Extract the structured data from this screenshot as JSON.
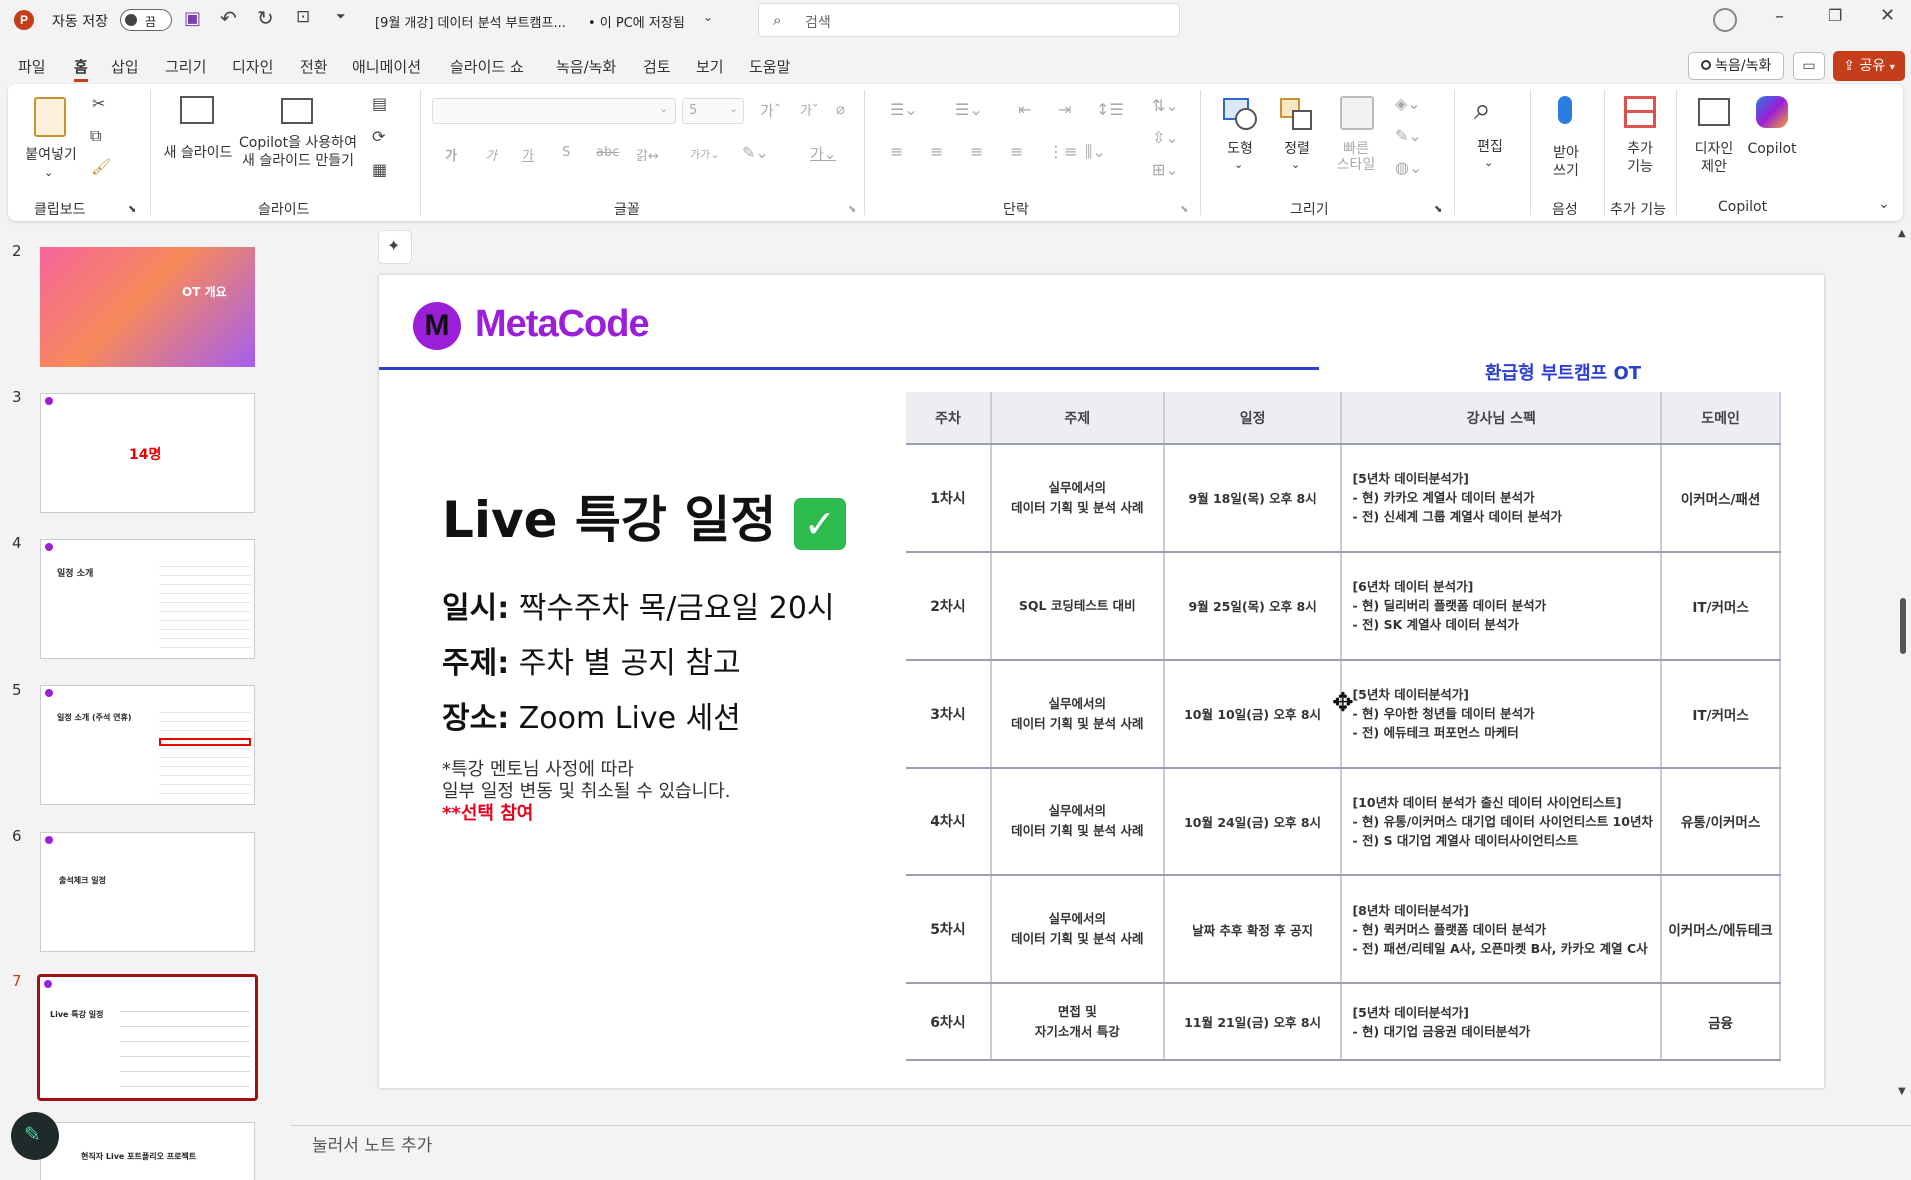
{
  "titlebar": {
    "autosave_label": "자동 저장",
    "autosave_state": "끔",
    "doc_title": "[9월 개강] 데이터 분석 부트캠프...",
    "save_location": "• 이 PC에 저장됨",
    "search_placeholder": "검색"
  },
  "menu": [
    "파일",
    "홈",
    "삽입",
    "그리기",
    "디자인",
    "전환",
    "애니메이션",
    "슬라이드 쇼",
    "녹음/녹화",
    "검토",
    "보기",
    "도움말"
  ],
  "menu_right": {
    "record": "녹음/녹화",
    "share": "공유"
  },
  "ribbon": {
    "paste": "붙여넣기",
    "new_slide": "새 슬라이드",
    "copilot_new_1": "Copilot을 사용하여",
    "copilot_new_2": "새 슬라이드 만들기",
    "font_size": "5",
    "shape": "도형",
    "arrange": "정렬",
    "quick_style_1": "빠른",
    "quick_style_2": "스타일",
    "edit": "편집",
    "dictate_1": "받아",
    "dictate_2": "쓰기",
    "addins_1": "추가",
    "addins_2": "기능",
    "designer_1": "디자인",
    "designer_2": "제안",
    "copilot": "Copilot",
    "groups": {
      "clipboard": "클립보드",
      "slides": "슬라이드",
      "font": "글꼴",
      "paragraph": "단락",
      "drawing": "그리기",
      "voice": "음성",
      "addins": "추가 기능",
      "copilot": "Copilot"
    }
  },
  "thumbnails": [
    {
      "num": "2",
      "title": "OT 개요"
    },
    {
      "num": "3",
      "title": "14명"
    },
    {
      "num": "4",
      "title": "일정 소개"
    },
    {
      "num": "5",
      "title": "일정 소개 (주석 연휴)"
    },
    {
      "num": "6",
      "title": "출석체크 일정"
    },
    {
      "num": "7",
      "title": "Live 특강 일정"
    },
    {
      "num": "",
      "title": "현직자 Live 포트폴리오 프로젝트"
    }
  ],
  "slide": {
    "brand": "MetaCode",
    "header_right": "환급형 부트캠프 OT",
    "heading": "Live 특강 일정",
    "info": [
      {
        "label": "일시:",
        "value": "짝수주차 목/금요일 20시"
      },
      {
        "label": "주제:",
        "value": "주차 별 공지 참고"
      },
      {
        "label": "장소:",
        "value": "Zoom Live 세션"
      }
    ],
    "note_1": "*특강 멘토님 사정에 따라",
    "note_2": "일부 일정 변동 및 취소될 수 있습니다.",
    "note_3": "**선택 참여",
    "table": {
      "headers": [
        "주차",
        "주제",
        "일정",
        "강사님 스펙",
        "도메인"
      ],
      "rows": [
        {
          "week": "1차시",
          "topic": [
            "실무에서의",
            "데이터 기획 및 분석 사례"
          ],
          "date": "9월 18일(목) 오후 8시",
          "spec": [
            "[5년차 데이터분석가]",
            "- 현) 카카오 계열사 데이터 분석가",
            "- 전) 신세계 그룹 계열사 데이터 분석가"
          ],
          "domain": "이커머스/패션"
        },
        {
          "week": "2차시",
          "topic": [
            "SQL 코딩테스트 대비"
          ],
          "date": "9월 25일(목) 오후 8시",
          "spec": [
            "[6년차 데이터 분석가]",
            "- 현) 딜리버리 플랫폼 데이터 분석가",
            "- 전) SK 계열사 데이터 분석가"
          ],
          "domain": "IT/커머스"
        },
        {
          "week": "3차시",
          "topic": [
            "실무에서의",
            "데이터 기획 및 분석 사례"
          ],
          "date": "10월 10일(금) 오후 8시",
          "spec": [
            "[5년차 데이터분석가]",
            "- 현) 우아한 청년들 데이터 분석가",
            "- 전) 에듀테크 퍼포먼스 마케터"
          ],
          "domain": "IT/커머스"
        },
        {
          "week": "4차시",
          "topic": [
            "실무에서의",
            "데이터 기획 및 분석 사례"
          ],
          "date": "10월 24일(금) 오후 8시",
          "spec": [
            "[10년차 데이터 분석가 출신 데이터 사이언티스트]",
            "- 현) 유통/이커머스 대기업 데이터 사이언티스트 10년차",
            "- 전) S 대기업 계열사 데이터사이언티스트"
          ],
          "domain": "유통/이커머스"
        },
        {
          "week": "5차시",
          "topic": [
            "실무에서의",
            "데이터 기획 및 분석 사례"
          ],
          "date": "날짜 추후 확정 후 공지",
          "spec": [
            "[8년차 데이터분석가]",
            "- 현) 퀵커머스 플랫폼 데이터 분석가",
            "- 전) 패션/리테일 A사, 오픈마켓 B사, 카카오 계열 C사"
          ],
          "domain": "이커머스/에듀테크"
        },
        {
          "week": "6차시",
          "topic": [
            "면접 및",
            "자기소개서 특강"
          ],
          "date": "11월 21일(금) 오후 8시",
          "spec": [
            "[5년차 데이터분석가]",
            "- 현) 대기업 금융권 데이터분석가"
          ],
          "domain": "금융"
        }
      ]
    }
  },
  "notes_placeholder": "눌러서 노트 추가",
  "colors": {
    "accent": "#c43e1c",
    "brand": "#9b1fd8",
    "blue_line": "#2b3fd0",
    "red_note": "#e8001c"
  }
}
